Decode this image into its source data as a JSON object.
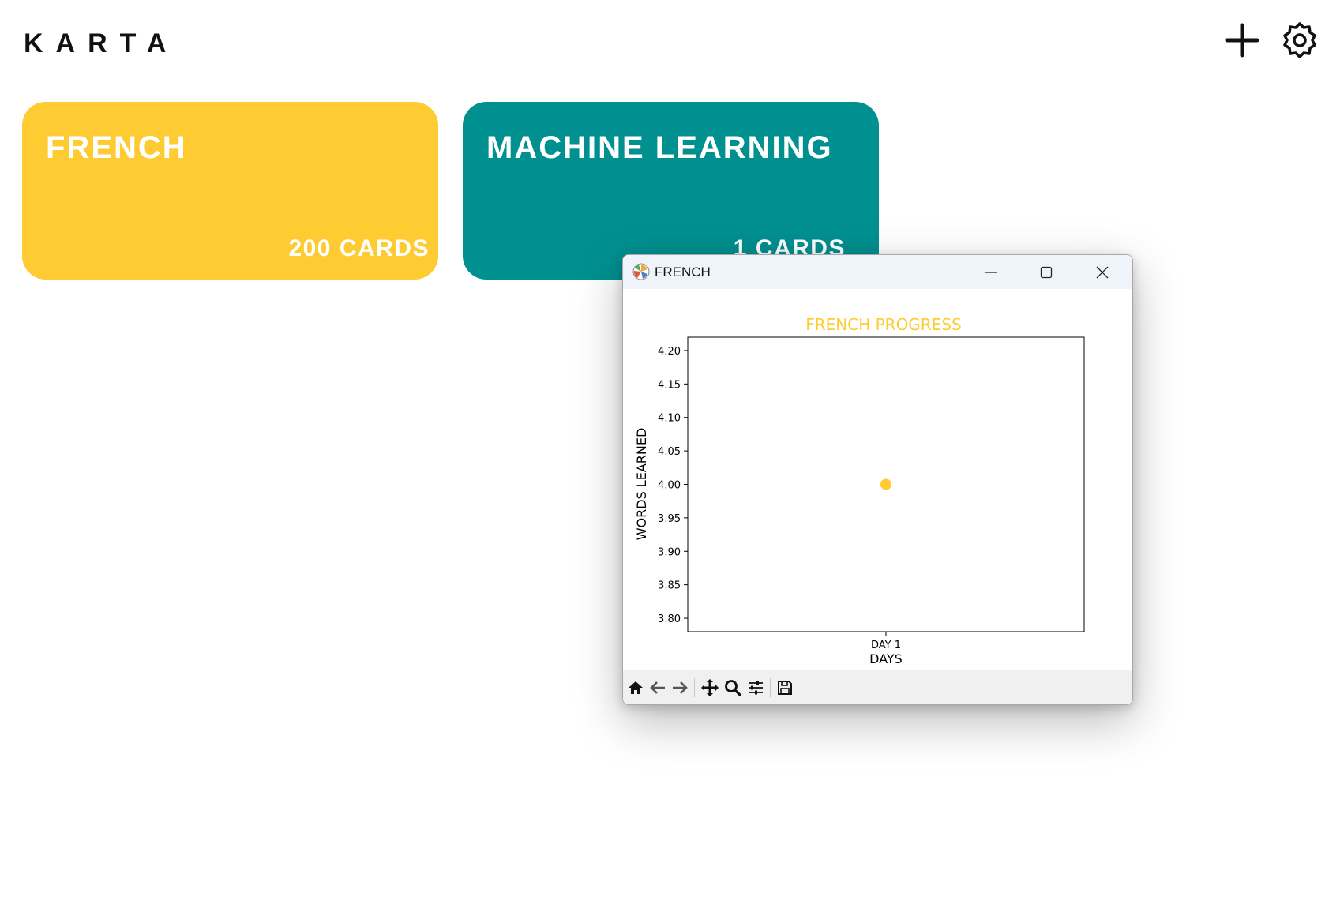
{
  "app": {
    "title": "KARTA"
  },
  "header": {
    "add_icon": "plus-icon",
    "settings_icon": "gear-icon"
  },
  "decks": [
    {
      "name": "FRENCH",
      "count": "200 CARDS",
      "color": "#ffcb33"
    },
    {
      "name": "MACHINE LEARNING",
      "count": "1 CARDS",
      "color": "#009090"
    }
  ],
  "window": {
    "title": "FRENCH",
    "buttons": [
      "minimize-icon",
      "maximize-icon",
      "close-icon"
    ]
  },
  "chart_data": {
    "type": "scatter",
    "title": "FRENCH PROGRESS",
    "xlabel": "DAYS",
    "ylabel": "WORDS LEARNED",
    "categories": [
      "DAY 1"
    ],
    "series": [
      {
        "x": [
          "DAY 1"
        ],
        "y": [
          4.0
        ],
        "color": "#ffcb33"
      }
    ],
    "ylim": [
      3.78,
      4.22
    ],
    "yticks": [
      "3.80",
      "3.85",
      "3.90",
      "3.95",
      "4.00",
      "4.05",
      "4.10",
      "4.15",
      "4.20"
    ],
    "title_color": "#ffcb33",
    "grid": false,
    "legend": "none"
  },
  "toolbar": {
    "icons": [
      "home-icon",
      "back-icon",
      "forward-icon",
      "pan-icon",
      "zoom-icon",
      "configure-subplots-icon",
      "save-icon"
    ]
  }
}
